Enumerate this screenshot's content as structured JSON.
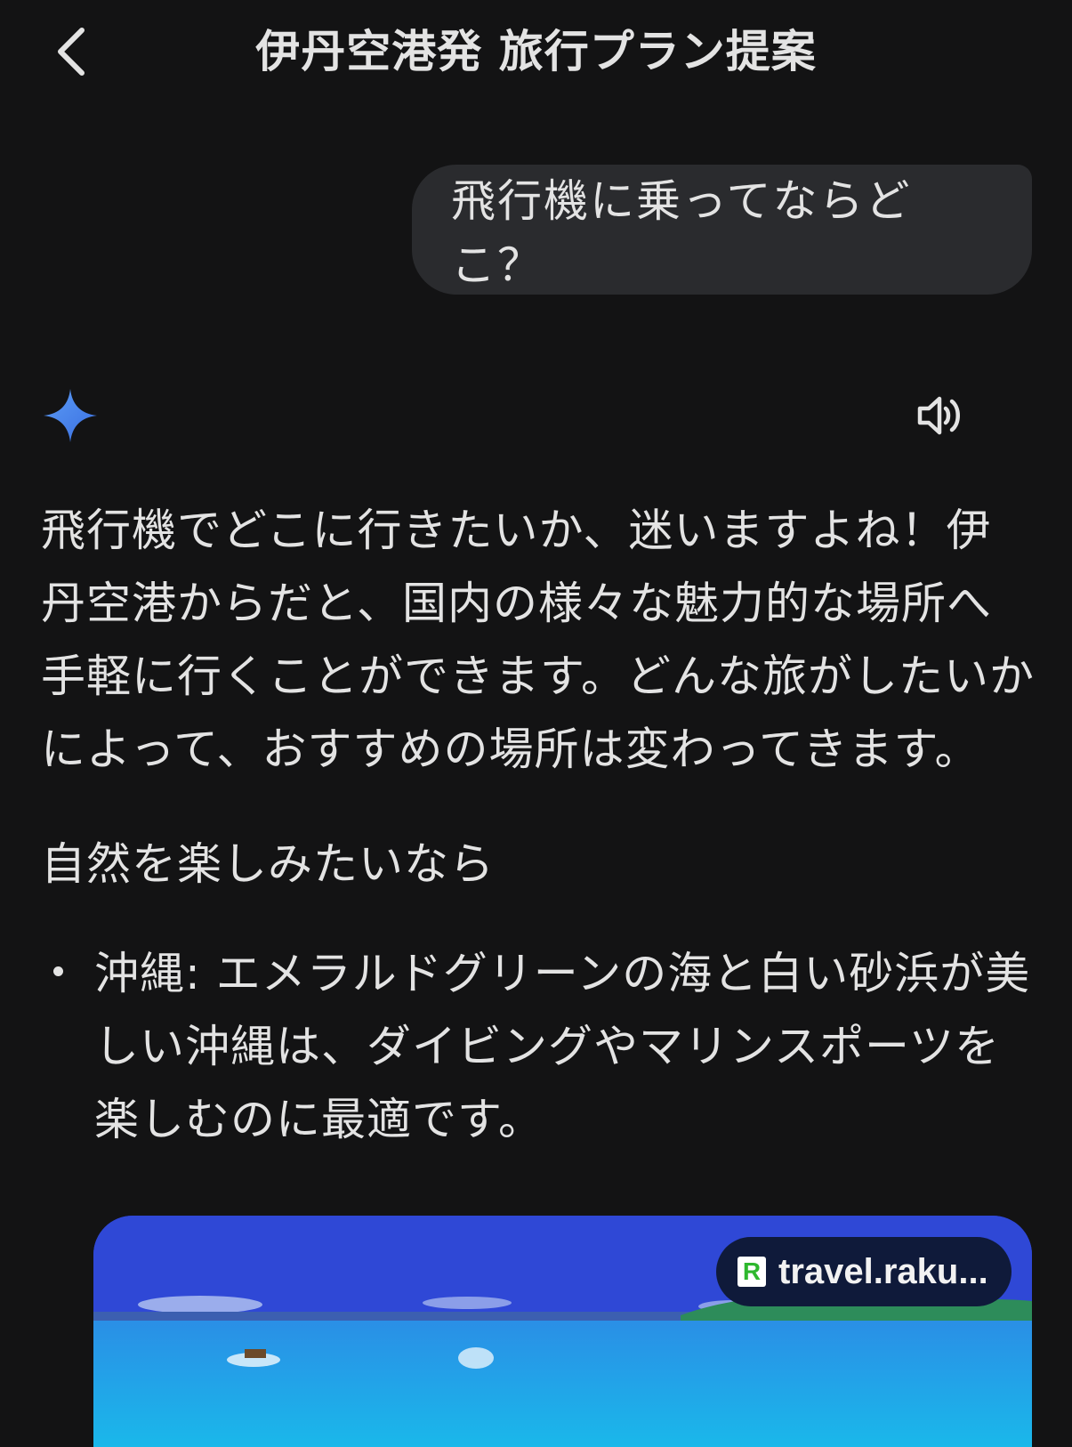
{
  "header": {
    "title": "伊丹空港発 旅行プラン提案",
    "back_icon": "chevron-left-icon"
  },
  "user_message": {
    "text": "飛行機に乗ってならどこ？"
  },
  "assistant": {
    "avatar_icon": "gemini-sparkle-icon",
    "speaker_icon": "volume-icon",
    "intro_lines": [
      "飛行機でどこに行きたいか、迷いますよね！伊",
      "丹空港からだと、国内の様々な魅力的な場所へ",
      "手軽に行くことができます。どんな旅がしたいか",
      "によって、おすすめの場所は変わってきます。"
    ],
    "section_heading": "自然を楽しみたいなら",
    "bullets": [
      {
        "lines": [
          "沖縄: エメラルドグリーンの海と白い砂浜が美",
          "しい沖縄は、ダイビングやマリンスポーツを",
          "楽しむのに最適です。"
        ]
      }
    ],
    "image_card": {
      "source_badge": "R",
      "source_label": "travel.raku..."
    }
  },
  "colors": {
    "background": "#131314",
    "user_bubble": "#2a2b2e",
    "text": "#e3e3e3",
    "sparkle_start": "#4f8df5",
    "sparkle_end": "#3d6fe0"
  }
}
